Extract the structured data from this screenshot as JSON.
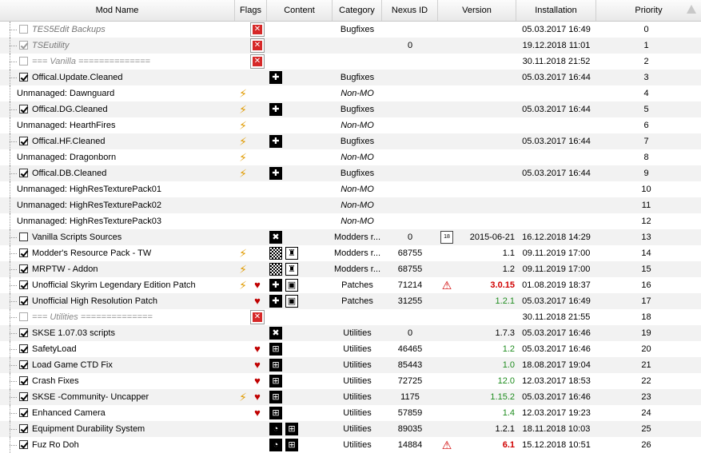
{
  "headers": [
    "Mod Name",
    "Flags",
    "Content",
    "Category",
    "Nexus ID",
    "Version",
    "Installation",
    "Priority"
  ],
  "rows": [
    {
      "name": "TES5Edit Backups",
      "style": "grey",
      "tree": "line",
      "cb": "empty",
      "flags": [
        "x"
      ],
      "content": [],
      "category": "Bugfixes",
      "nexus": "",
      "version": "",
      "vclass": "",
      "install": "05.03.2017 16:49",
      "priority": "0",
      "vicon": ""
    },
    {
      "name": "TSEutility",
      "style": "grey",
      "tree": "line",
      "cb": "checked",
      "flags": [
        "x"
      ],
      "content": [],
      "category": "",
      "nexus": "0",
      "version": "",
      "vclass": "",
      "install": "19.12.2018 11:01",
      "priority": "1",
      "vicon": ""
    },
    {
      "name": "=== Vanilla ==============",
      "style": "sep",
      "tree": "line",
      "cb": "empty",
      "flags": [
        "x"
      ],
      "content": [],
      "category": "",
      "nexus": "",
      "version": "",
      "vclass": "",
      "install": "30.11.2018 21:52",
      "priority": "2",
      "vicon": ""
    },
    {
      "name": "Offical.Update.Cleaned",
      "style": "",
      "tree": "line",
      "cb": "checked",
      "flags": [],
      "content": [
        "puzzle"
      ],
      "category": "Bugfixes",
      "nexus": "",
      "version": "",
      "vclass": "",
      "install": "05.03.2017 16:44",
      "priority": "3",
      "vicon": ""
    },
    {
      "name": "Unmanaged: Dawnguard",
      "style": "",
      "tree": "line",
      "cb": "none",
      "flags": [
        "bolt"
      ],
      "content": [],
      "category": "Non-MO",
      "nexus": "",
      "version": "",
      "vclass": "",
      "install": "",
      "priority": "4",
      "vicon": ""
    },
    {
      "name": "Offical.DG.Cleaned",
      "style": "",
      "tree": "line",
      "cb": "checked",
      "flags": [
        "bolt2"
      ],
      "content": [
        "puzzle"
      ],
      "category": "Bugfixes",
      "nexus": "",
      "version": "",
      "vclass": "",
      "install": "05.03.2017 16:44",
      "priority": "5",
      "vicon": ""
    },
    {
      "name": "Unmanaged: HearthFires",
      "style": "",
      "tree": "line",
      "cb": "none",
      "flags": [
        "bolt"
      ],
      "content": [],
      "category": "Non-MO",
      "nexus": "",
      "version": "",
      "vclass": "",
      "install": "",
      "priority": "6",
      "vicon": ""
    },
    {
      "name": "Offical.HF.Cleaned",
      "style": "",
      "tree": "line",
      "cb": "checked",
      "flags": [
        "bolt2"
      ],
      "content": [
        "puzzle"
      ],
      "category": "Bugfixes",
      "nexus": "",
      "version": "",
      "vclass": "",
      "install": "05.03.2017 16:44",
      "priority": "7",
      "vicon": ""
    },
    {
      "name": "Unmanaged: Dragonborn",
      "style": "",
      "tree": "line",
      "cb": "none",
      "flags": [
        "bolt"
      ],
      "content": [],
      "category": "Non-MO",
      "nexus": "",
      "version": "",
      "vclass": "",
      "install": "",
      "priority": "8",
      "vicon": ""
    },
    {
      "name": "Offical.DB.Cleaned",
      "style": "",
      "tree": "line",
      "cb": "checked",
      "flags": [
        "bolt2"
      ],
      "content": [
        "puzzle"
      ],
      "category": "Bugfixes",
      "nexus": "",
      "version": "",
      "vclass": "",
      "install": "05.03.2017 16:44",
      "priority": "9",
      "vicon": ""
    },
    {
      "name": "Unmanaged: HighResTexturePack01",
      "style": "",
      "tree": "line",
      "cb": "none",
      "flags": [],
      "content": [],
      "category": "Non-MO",
      "nexus": "",
      "version": "",
      "vclass": "",
      "install": "",
      "priority": "10",
      "vicon": ""
    },
    {
      "name": "Unmanaged: HighResTexturePack02",
      "style": "",
      "tree": "line",
      "cb": "none",
      "flags": [],
      "content": [],
      "category": "Non-MO",
      "nexus": "",
      "version": "",
      "vclass": "",
      "install": "",
      "priority": "11",
      "vicon": ""
    },
    {
      "name": "Unmanaged: HighResTexturePack03",
      "style": "",
      "tree": "line",
      "cb": "none",
      "flags": [],
      "content": [],
      "category": "Non-MO",
      "nexus": "",
      "version": "",
      "vclass": "",
      "install": "",
      "priority": "12",
      "vicon": ""
    },
    {
      "name": "Vanilla Scripts Sources",
      "style": "",
      "tree": "line",
      "cb": "empty",
      "flags": [],
      "content": [
        "tools"
      ],
      "category": "Modders r...",
      "nexus": "0",
      "version": "2015-06-21",
      "vclass": "",
      "install": "16.12.2018 14:29",
      "priority": "13",
      "vicon": "cal"
    },
    {
      "name": "Modder's Resource Pack - TW",
      "style": "",
      "tree": "line",
      "cb": "checked",
      "flags": [
        "bolt"
      ],
      "content": [
        "checker",
        "mesh"
      ],
      "category": "Modders r...",
      "nexus": "68755",
      "version": "1.1",
      "vclass": "",
      "install": "09.11.2019 17:00",
      "priority": "14",
      "vicon": ""
    },
    {
      "name": "MRPTW - Addon",
      "style": "",
      "tree": "line",
      "cb": "checked",
      "flags": [
        "bolt2"
      ],
      "content": [
        "checker",
        "mesh"
      ],
      "category": "Modders r...",
      "nexus": "68755",
      "version": "1.2",
      "vclass": "",
      "install": "09.11.2019 17:00",
      "priority": "15",
      "vicon": ""
    },
    {
      "name": "Unofficial Skyrim Legendary Edition Patch",
      "style": "",
      "tree": "line",
      "cb": "checked",
      "flags": [
        "bolt2",
        "heart"
      ],
      "content": [
        "puzzle",
        "cube"
      ],
      "category": "Patches",
      "nexus": "71214",
      "version": "3.0.15",
      "vclass": "red",
      "install": "01.08.2019 18:37",
      "priority": "16",
      "vicon": "warn"
    },
    {
      "name": "Unofficial High Resolution Patch",
      "style": "",
      "tree": "line",
      "cb": "checked",
      "flags": [
        "heart"
      ],
      "content": [
        "puzzle",
        "cube"
      ],
      "category": "Patches",
      "nexus": "31255",
      "version": "1.2.1",
      "vclass": "green",
      "install": "05.03.2017 16:49",
      "priority": "17",
      "vicon": ""
    },
    {
      "name": "=== Utilities ==============",
      "style": "sep",
      "tree": "line",
      "cb": "empty",
      "flags": [
        "x"
      ],
      "content": [],
      "category": "",
      "nexus": "",
      "version": "",
      "vclass": "",
      "install": "30.11.2018 21:55",
      "priority": "18",
      "vicon": ""
    },
    {
      "name": "SKSE 1.07.03 scripts",
      "style": "",
      "tree": "line",
      "cb": "checked",
      "flags": [],
      "content": [
        "tools"
      ],
      "category": "Utilities",
      "nexus": "0",
      "version": "1.7.3",
      "vclass": "",
      "install": "05.03.2017 16:46",
      "priority": "19",
      "vicon": ""
    },
    {
      "name": "SafetyLoad",
      "style": "",
      "tree": "line",
      "cb": "checked",
      "flags": [
        "heart"
      ],
      "content": [
        "plugin"
      ],
      "category": "Utilities",
      "nexus": "46465",
      "version": "1.2",
      "vclass": "green",
      "install": "05.03.2017 16:46",
      "priority": "20",
      "vicon": ""
    },
    {
      "name": "Load Game CTD Fix",
      "style": "",
      "tree": "line",
      "cb": "checked",
      "flags": [
        "heart"
      ],
      "content": [
        "plugin"
      ],
      "category": "Utilities",
      "nexus": "85443",
      "version": "1.0",
      "vclass": "green",
      "install": "18.08.2017 19:04",
      "priority": "21",
      "vicon": ""
    },
    {
      "name": "Crash Fixes",
      "style": "",
      "tree": "line",
      "cb": "checked",
      "flags": [
        "heart"
      ],
      "content": [
        "plugin"
      ],
      "category": "Utilities",
      "nexus": "72725",
      "version": "12.0",
      "vclass": "green",
      "install": "12.03.2017 18:53",
      "priority": "22",
      "vicon": ""
    },
    {
      "name": "SKSE -Community- Uncapper",
      "style": "",
      "tree": "line",
      "cb": "checked",
      "flags": [
        "bolt",
        "heart"
      ],
      "content": [
        "plugin"
      ],
      "category": "Utilities",
      "nexus": "1175",
      "version": "1.15.2",
      "vclass": "green",
      "install": "05.03.2017 16:46",
      "priority": "23",
      "vicon": ""
    },
    {
      "name": "Enhanced Camera",
      "style": "",
      "tree": "line",
      "cb": "checked",
      "flags": [
        "heart"
      ],
      "content": [
        "plugin"
      ],
      "category": "Utilities",
      "nexus": "57859",
      "version": "1.4",
      "vclass": "green",
      "install": "12.03.2017 19:23",
      "priority": "24",
      "vicon": ""
    },
    {
      "name": "Equipment Durability System",
      "style": "",
      "tree": "line",
      "cb": "checked",
      "flags": [],
      "content": [
        "clock",
        "plugin"
      ],
      "category": "Utilities",
      "nexus": "89035",
      "version": "1.2.1",
      "vclass": "",
      "install": "18.11.2018 10:03",
      "priority": "25",
      "vicon": ""
    },
    {
      "name": "Fuz Ro Doh",
      "style": "",
      "tree": "line",
      "cb": "checked",
      "flags": [],
      "content": [
        "clock",
        "plugin"
      ],
      "category": "Utilities",
      "nexus": "14884",
      "version": "6.1",
      "vclass": "red",
      "install": "15.12.2018 10:51",
      "priority": "26",
      "vicon": "warn"
    }
  ],
  "icons": {
    "x": {
      "glyph": "✕",
      "name": "error-x-icon"
    },
    "bolt": {
      "glyph": "⚡",
      "name": "unmanaged-bolt-icon"
    },
    "bolt2": {
      "glyph": "⚡",
      "name": "alternate-bolt-icon"
    },
    "heart": {
      "glyph": "♥",
      "name": "endorsed-heart-icon"
    },
    "puzzle": {
      "glyph": "✚",
      "name": "plugin-puzzle-icon"
    },
    "tools": {
      "glyph": "✖",
      "name": "scripts-tools-icon"
    },
    "checker": {
      "glyph": "",
      "name": "textures-checker-icon"
    },
    "mesh": {
      "glyph": "♜",
      "name": "meshes-icon"
    },
    "cube": {
      "glyph": "▣",
      "name": "interface-cube-icon"
    },
    "plugin": {
      "glyph": "⊞",
      "name": "skse-plugin-icon"
    },
    "clock": {
      "glyph": "◔",
      "name": "mcm-clock-icon"
    },
    "cal": {
      "glyph": "18",
      "name": "calendar-icon"
    },
    "warn": {
      "glyph": "⚠",
      "name": "warning-triangle-icon"
    }
  }
}
